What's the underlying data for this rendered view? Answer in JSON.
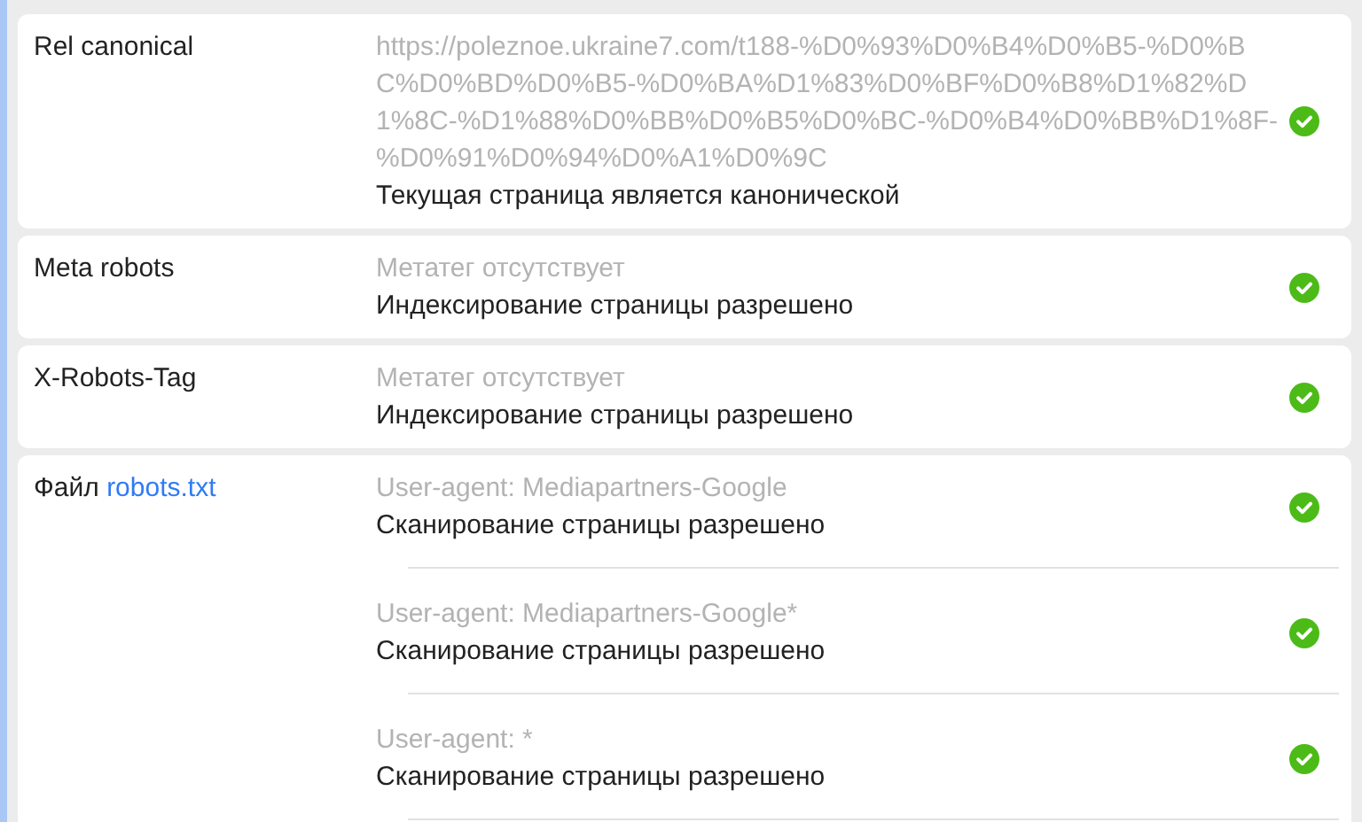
{
  "rows": [
    {
      "label": "Rel canonical",
      "entries": [
        {
          "value": "https://poleznoe.ukraine7.com/t188-%D0%93%D0%B4%D0%B5-%D0%BC%D0%BD%D0%B5-%D0%BA%D1%83%D0%BF%D0%B8%D1%82%D1%8C-%D1%88%D0%BB%D0%B5%D0%BC-%D0%B4%D0%BB%D1%8F-%D0%91%D0%94%D0%A1%D0%9C",
          "note": "Текущая страница является канонической"
        }
      ]
    },
    {
      "label": "Meta robots",
      "entries": [
        {
          "value": "Метатег отсутствует",
          "note": "Индексирование страницы разрешено"
        }
      ]
    },
    {
      "label": "X-Robots-Tag",
      "entries": [
        {
          "value": "Метатег отсутствует",
          "note": "Индексирование страницы разрешено"
        }
      ]
    },
    {
      "label": "Файл",
      "link": "robots.txt",
      "entries": [
        {
          "value": "User-agent: Mediapartners-Google",
          "note": "Сканирование страницы разрешено"
        },
        {
          "value": "User-agent: Mediapartners-Google*",
          "note": "Сканирование страницы разрешено"
        },
        {
          "value": "User-agent: *",
          "note": "Сканирование страницы разрешено"
        }
      ]
    }
  ]
}
